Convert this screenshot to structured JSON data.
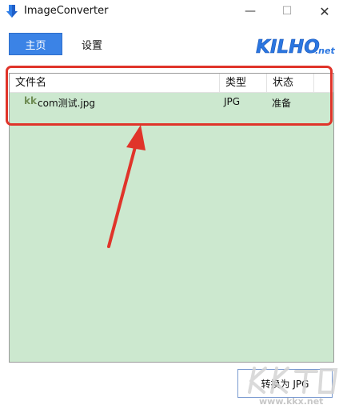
{
  "window": {
    "title": "ImageConverter",
    "minimize": "—",
    "maximize": "☐",
    "close": "✕"
  },
  "nav": {
    "home_label": "主页",
    "settings_label": "设置"
  },
  "logo": {
    "text": "KILHO",
    "suffix": ".net"
  },
  "table": {
    "columns": [
      "文件名",
      "类型",
      "状态"
    ],
    "rows": [
      {
        "icon_text": "kk",
        "name": "com测试.jpg",
        "type": "JPG",
        "status": "准备"
      }
    ]
  },
  "actions": {
    "convert_label": "转换为 JPG"
  },
  "watermark": {
    "text": "www.kkx.net"
  },
  "colors": {
    "accent": "#3b83e6",
    "list_bg": "#cce8cf",
    "annotation": "#e0342a"
  }
}
